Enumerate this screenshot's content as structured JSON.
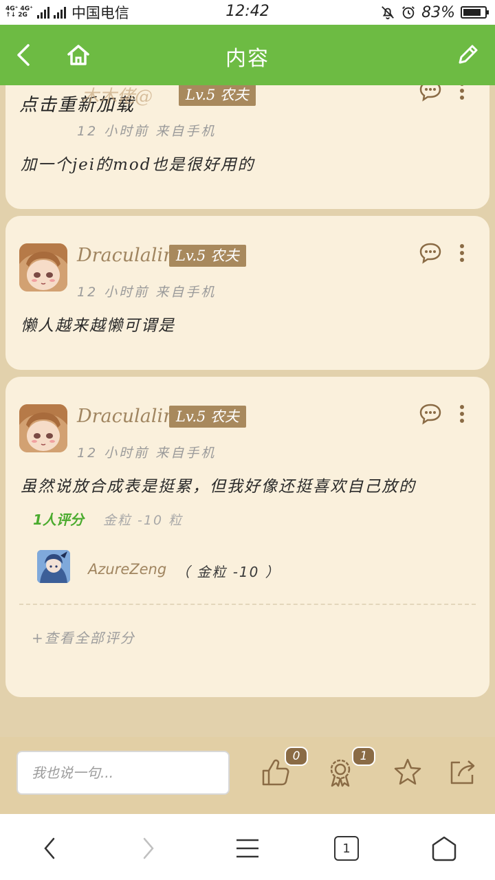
{
  "status_bar": {
    "signal_top": "4G⁺ 4G⁺",
    "signal_bottom": "↑↓ 2G",
    "carrier": "中国电信",
    "time": "12:42",
    "battery": "83%",
    "battery_level": 0.83
  },
  "header": {
    "title": "内容"
  },
  "posts": [
    {
      "username_partial": "点击重新加载",
      "overlay_text": "木木佬@",
      "level": "Lv.5 农夫",
      "meta": "12 小时前 来自手机",
      "body": "加一个jei的mod也是很好用的"
    },
    {
      "username": "Draculalin",
      "level": "Lv.5 农夫",
      "meta": "12 小时前 来自手机",
      "body": "懒人越来越懒可谓是"
    },
    {
      "username": "Draculalin",
      "level": "Lv.5 农夫",
      "meta": "12 小时前 来自手机",
      "body": "虽然说放合成表是挺累，但我好像还挺喜欢自己放的",
      "rating": {
        "count_label": "1人评分",
        "summary": "金粒 -10 粒",
        "raters": [
          {
            "name": "AzureZeng",
            "detail": "（ 金粒 -10 ）"
          }
        ],
        "view_all": "+查看全部评分"
      }
    }
  ],
  "action_bar": {
    "reply_placeholder": "我也说一句...",
    "like_count": "0",
    "award_count": "1"
  },
  "nav_bar": {
    "tab_count": "1"
  },
  "colors": {
    "header_green": "#6dbb43",
    "page_bg": "#e2d1ac",
    "card_bg": "#faf0dc",
    "level_badge": "#a8895d",
    "username": "#a08560",
    "rating_green": "#4aab2e",
    "icon_brown": "#8a6b45"
  }
}
